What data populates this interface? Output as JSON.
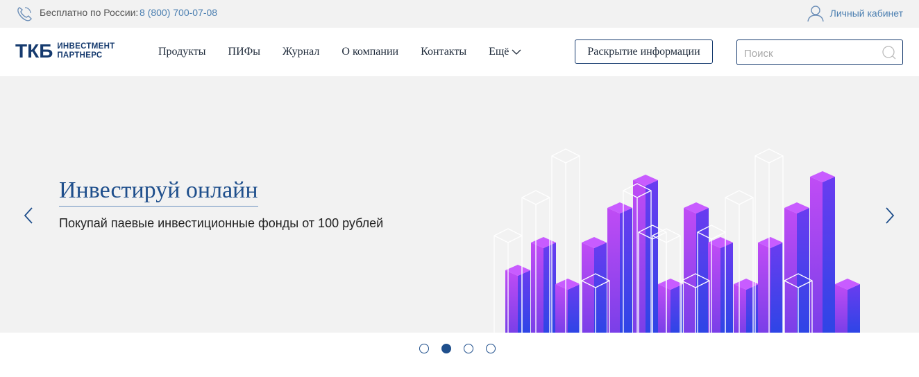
{
  "topbar": {
    "free_label": "Бесплатно по России:",
    "phone": "8 (800) 700-07-08",
    "cabinet_label": "Личный кабинет"
  },
  "logo": {
    "mark": "ТКБ",
    "line1": "ИНВЕСТМЕНТ",
    "line2": "ПАРТНЕРС"
  },
  "nav": {
    "items": [
      "Продукты",
      "ПИФы",
      "Журнал",
      "О компании",
      "Контакты"
    ],
    "more_label": "Ещё"
  },
  "disclosure_label": "Раскрытие информации",
  "search": {
    "placeholder": "Поиск"
  },
  "hero": {
    "title": "Инвестируй онлайн",
    "subtitle": "Покупай паевые инвестиционные фонды от 100 рублей"
  },
  "slider": {
    "total": 4,
    "active_index": 2
  },
  "colors": {
    "brand": "#153a6e",
    "link": "#4a7eb0",
    "hero_bg": "#f2f2f2",
    "bar_top": "#b44dff",
    "bar_side": "#3b3be0"
  }
}
